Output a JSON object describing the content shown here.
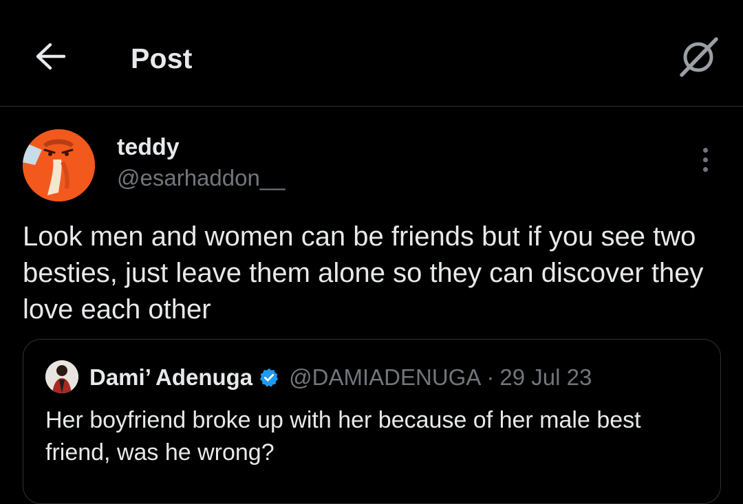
{
  "header": {
    "title": "Post",
    "back_icon": "arrow-left-icon",
    "grok_icon": "grok-icon"
  },
  "post": {
    "author_name": "teddy",
    "author_handle": "@esarhaddon__",
    "avatar_bg": "#f3591c",
    "text": "Look men and women can be friends but if you see two besties, just leave them alone so they can discover they love each other",
    "more_icon": "more-vertical-icon"
  },
  "quote": {
    "author_name": "Dami’ Adenuga",
    "verified": true,
    "author_handle": "@DAMIADENUGA",
    "separator": "·",
    "date": "29 Jul 23",
    "text": "Her boyfriend broke up with her because of her male best friend, was he wrong?"
  },
  "colors": {
    "background": "#000000",
    "primary_text": "#e7e9ea",
    "secondary_text": "#71767b",
    "border": "#2f3336",
    "verified": "#1d9bf0"
  }
}
